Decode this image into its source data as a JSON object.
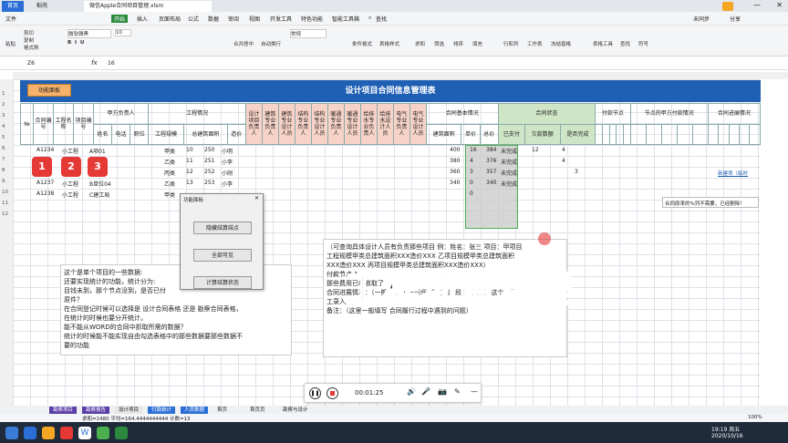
{
  "tabs": {
    "home": "首页",
    "daoke": "稻壳",
    "file": "微信Apple合同项目管理.xlsm"
  },
  "menu": {
    "file": "文件",
    "start": "开始",
    "insert": "插入",
    "layout": "页面布局",
    "formula": "公式",
    "data": "数据",
    "review": "审阅",
    "view": "视图",
    "dev": "开发工具",
    "special": "特色功能",
    "smart": "智能工具箱",
    "search": "查找",
    "unsync": "未同步",
    "share": "分享"
  },
  "ribbon": {
    "paste": "粘贴",
    "cut": "剪切",
    "copy": "复制",
    "painter": "格式刷",
    "font": "微软雅黑",
    "size": "10",
    "merge": "合并居中",
    "wrap": "自动换行",
    "format": "常规",
    "condfmt": "条件格式",
    "tablefmt": "表格样式",
    "sum": "求和",
    "filter": "筛选",
    "sort": "排序",
    "fill": "填充",
    "rowcol": "行和列",
    "sheet": "工作表",
    "freeze": "冻结窗格",
    "tabletool": "表格工具",
    "find": "查找",
    "symbol": "符号"
  },
  "formula_bar": {
    "cell": "Z6",
    "fx": "fx",
    "value": "16"
  },
  "sheet": {
    "func_btn": "功能面板",
    "title": "设计项目合同信息管理表",
    "headers": {
      "no": "№",
      "contract_no": "合同编号",
      "proj_name": "工程名称",
      "proj_no": "项目编号",
      "party_a": "甲方负责人",
      "name": "姓名",
      "phone": "电话",
      "post": "职位",
      "proj_info": "工程情况",
      "scale": "工程规模",
      "area": "总建筑面积",
      "cost": "造价",
      "design_lead": "设计项目负责人",
      "arch_pro": "建筑专业负责人",
      "arch_design": "建筑专业设计人员",
      "struct_pro": "结构专业负责人",
      "struct_design": "结构专业设计人员",
      "hvac_pro": "暖通专业负责人",
      "hvac_design": "暖通专业设计人员",
      "water_pro": "给排水专业负责人",
      "water_design": "给排水设计人员",
      "elec_pro": "电气专业负责人",
      "elec_design": "电气专业设计人员",
      "contract_basic": "合同基本情况",
      "build_area": "建筑面积",
      "unit_price": "单价",
      "total": "总价",
      "contract_status": "合同状态",
      "paid": "已支付",
      "owed": "欠款数额",
      "settled": "是否完成",
      "pay_nodes": "付款节点",
      "node_pay": "节点的甲方付款情况",
      "progress": "合同进展情况"
    },
    "rows": [
      {
        "id": "A1234",
        "name": "小工程",
        "code": "A项01",
        "scale": "甲类",
        "area": "10",
        "cost": "250",
        "lead": "小明",
        "total": "400",
        "paid": "16",
        "owed": "384",
        "done": "未完成",
        "n1": "12",
        "n2": "4"
      },
      {
        "id": "",
        "name": "",
        "code": "",
        "scale": "乙类",
        "area": "11",
        "cost": "251",
        "lead": "小李",
        "total": "380",
        "paid": "4",
        "owed": "376",
        "done": "未完成",
        "n1": "",
        "n2": "4"
      },
      {
        "id": "",
        "name": "",
        "code": "",
        "scale": "丙类",
        "area": "12",
        "cost": "252",
        "lead": "小刚",
        "total": "360",
        "paid": "3",
        "owed": "357",
        "done": "未完成",
        "n1": "",
        "n2": "",
        "n3": "3"
      },
      {
        "id": "A1237",
        "name": "小工程",
        "code": "B单位04",
        "scale": "乙类",
        "area": "13",
        "cost": "253",
        "lead": "小李",
        "total": "340",
        "paid": "0",
        "owed": "340",
        "done": "未完成"
      },
      {
        "id": "A1238",
        "name": "小工程",
        "code": "C建工局",
        "scale": "甲类",
        "area": "",
        "cost": "",
        "lead": "",
        "total": "",
        "paid": "0",
        "owed": "",
        "done": ""
      }
    ],
    "row_numbers": [
      "1",
      "2",
      "3",
      "4",
      "5",
      "6",
      "7",
      "8",
      "9",
      "10",
      "11",
      "12"
    ],
    "badges": [
      "1",
      "2",
      "3"
    ],
    "side_note": "合同原来的%列不需要，已经删除！",
    "new_link": "新建项（临时"
  },
  "dialog": {
    "title": "功能面板",
    "btn1": "隐藏结算结点",
    "btn2": "全部可见",
    "btn3": "计算结算状态"
  },
  "note_left": [
    "这个是单个项目的一些数据:",
    "还要实现统计的功能，统计分为:",
    "目钱未到，那个节点没到，是否已付",
    "原件？",
    "在合同登记时候可以选择是 设计合同表格 还是 勘察合同表格，",
    "在统计的时候也要分开统计。",
    "能不能从WORD的合同中抓取所需的数据？",
    "统计的时候能不能实现自由勾选表格中的那些数据要那些数据不",
    "要的功能"
  ],
  "note_right": [
    "（可查询具体设计人员有负责那些项目 例：姓名：张三 项目：甲项目",
    "工程规模甲类总建筑面积XXX造价XXX 乙项目规模甲类总建筑面积",
    "XXX造价XXX 丙项目规模甲类总建筑面积XXX造价XXX）",
    "付款节点 1.",
    "那些费用已经收取了",
    "合同进展情况：（一般分为 方案阶段 施工图阶段 图审阶段 这个可手",
    "工录入）",
    "备注：（这里一般填写 合同履行过程中遇到的问题）"
  ],
  "overlay_title": "工程项目管理",
  "player": {
    "time": "00:01:25"
  },
  "sheet_tabs": [
    "勘察项目",
    "勘察报告",
    "设计项目",
    "付款统计",
    "人员数据",
    "首页",
    "首页页",
    "勘察与设计"
  ],
  "status": {
    "left": "求和=1480 平均=164.4444444444 计数=13",
    "right": "100%"
  },
  "taskbar": {
    "time": "19:19 周五",
    "date": "2020/10/16"
  },
  "colors": {
    "accent": "#1f5fb4",
    "dialog": "#f0f0f0",
    "badge": "#e53935"
  }
}
